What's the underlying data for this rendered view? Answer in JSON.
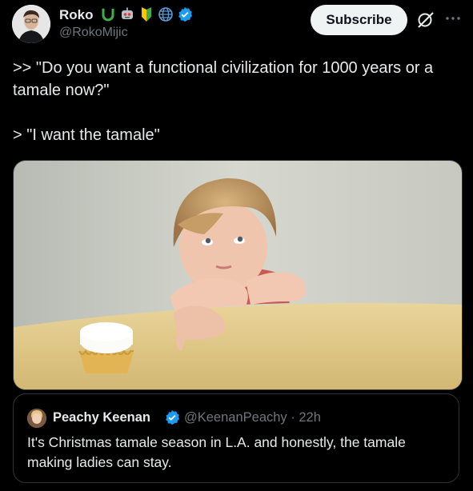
{
  "author": {
    "name": "Roko",
    "handle": "@RokoMijic",
    "emoji_icons": [
      "u-symbol-icon",
      "robot-icon",
      "beginner-shield-icon",
      "globe-icon",
      "verified-badge-icon"
    ]
  },
  "header_actions": {
    "subscribe_label": "Subscribe",
    "grok_icon": "grok-icon",
    "more_icon": "more-dots-icon"
  },
  "tweet": {
    "line1": ">> \"Do you want a functional civilization for 1000 years or a tamale now?\"",
    "line2": "> \"I want the tamale\""
  },
  "media": {
    "description_icon": "child-marshmallow-photo"
  },
  "quote": {
    "name": "Peachy Keenan",
    "handle_time": "@KeenanPeachy · 22h",
    "text": "It's Christmas tamale season in L.A. and honestly, the tamale making ladies can stay."
  },
  "colors": {
    "background": "#000000",
    "text": "#e7e9ea",
    "muted": "#71767b",
    "verified": "#1d9bf0",
    "border": "#2f3336"
  }
}
